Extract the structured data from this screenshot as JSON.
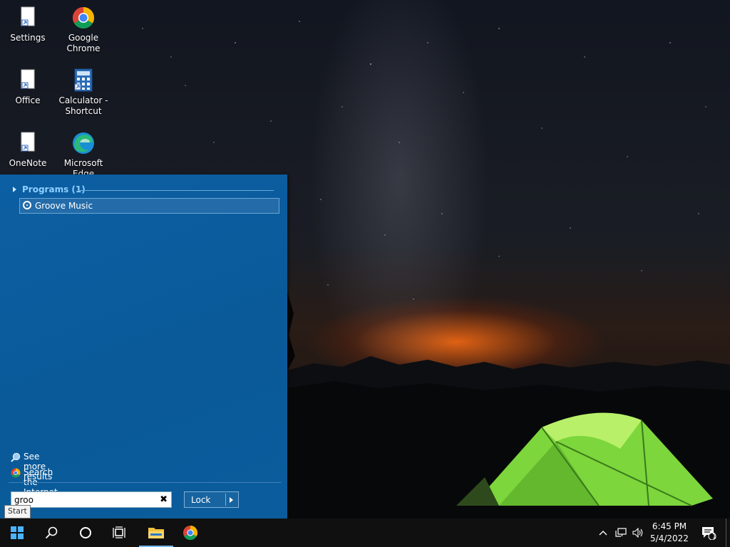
{
  "desktop": {
    "icons": [
      {
        "label_1": "Settings",
        "label_2": ""
      },
      {
        "label_1": "Google",
        "label_2": "Chrome"
      },
      {
        "label_1": "Office",
        "label_2": ""
      },
      {
        "label_1": "Calculator -",
        "label_2": "Shortcut"
      },
      {
        "label_1": "OneNote",
        "label_2": ""
      },
      {
        "label_1": "Microsoft",
        "label_2": "Edge"
      }
    ]
  },
  "start_menu": {
    "programs_header": "Programs (1)",
    "results": [
      {
        "label": "Groove Music",
        "icon": "groove-music-icon"
      }
    ],
    "see_more": "See more results",
    "search_internet": "Search the Internet",
    "search_value": "groo",
    "lock_label": "Lock"
  },
  "tooltip": "Start",
  "taskbar": {
    "items": [
      "start",
      "search",
      "cortana",
      "task-view",
      "file-explorer",
      "google-chrome"
    ],
    "time": "6:45 PM",
    "date": "5/4/2022",
    "notification_count": "1"
  },
  "colors": {
    "start_menu_bg": "#0b5c9c",
    "programs_header": "#8fd0ff",
    "taskbar_bg": "#101010",
    "accent": "#76b9ed"
  }
}
